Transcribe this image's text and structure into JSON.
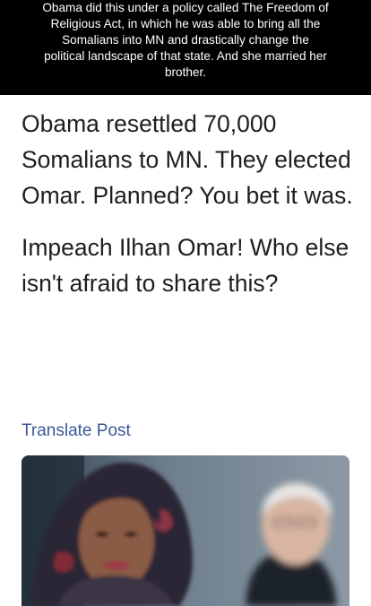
{
  "caption": {
    "lines": [
      "Obama did this under a policy called The Freedom of",
      "Religious Act, in which he was able to bring all the",
      "Somalians into MN and drastically change the",
      "political landscape of that state.  And she married her",
      "brother."
    ]
  },
  "post": {
    "paragraphs": [
      "Obama resettled 70,000 Somalians to MN. They elected Omar. Planned? You bet it was.",
      "Impeach Ilhan Omar! Who else isn't afraid to share this?"
    ],
    "translate_label": "Translate Post"
  },
  "colors": {
    "caption_bg": "#000000",
    "post_text": "#1c1e21",
    "link": "#385898"
  }
}
